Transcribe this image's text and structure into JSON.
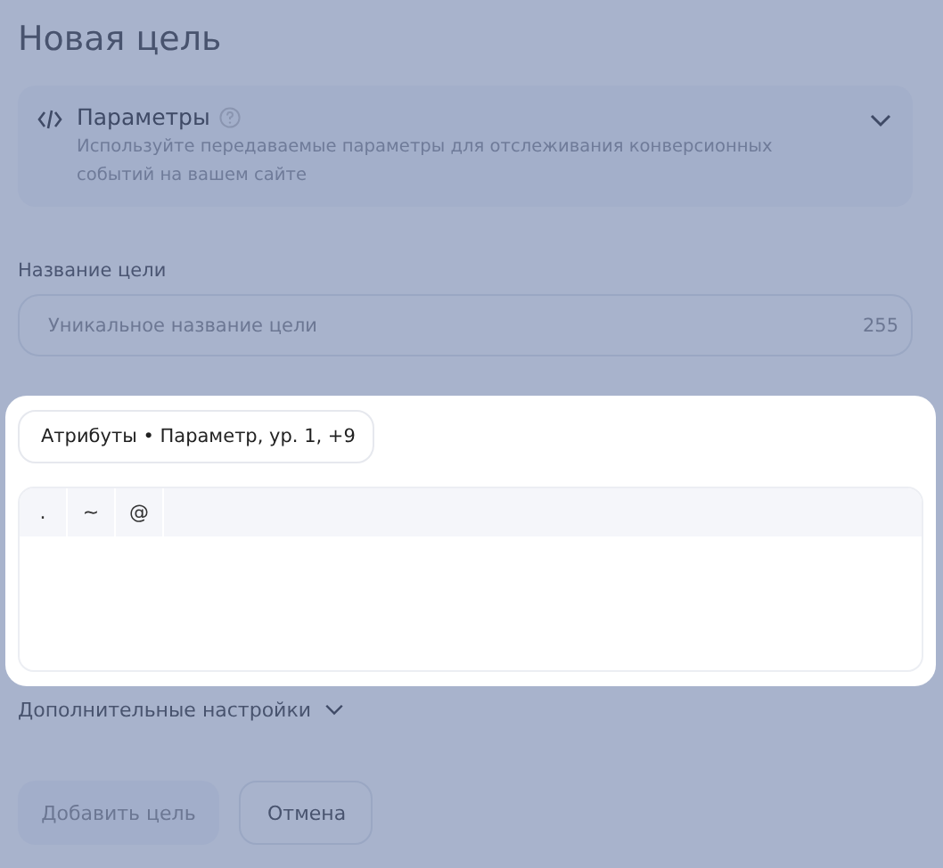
{
  "title": "Новая цель",
  "params": {
    "title": "Параметры",
    "description": "Используйте передаваемые параметры для отслеживания конверсионных событий на вашем сайте",
    "expanded": false
  },
  "name_field": {
    "label": "Название цели",
    "placeholder": "Уникальное название цели",
    "counter": "255"
  },
  "highlight": {
    "chip": "Атрибуты • Параметр, ур. 1, +9",
    "keys": [
      ".",
      "~",
      "@"
    ]
  },
  "advanced": {
    "label": "Дополнительные настройки",
    "expanded": false
  },
  "buttons": [
    {
      "label": "Добавить цель",
      "disabled": true
    },
    {
      "label": "Отмена",
      "disabled": false
    }
  ]
}
